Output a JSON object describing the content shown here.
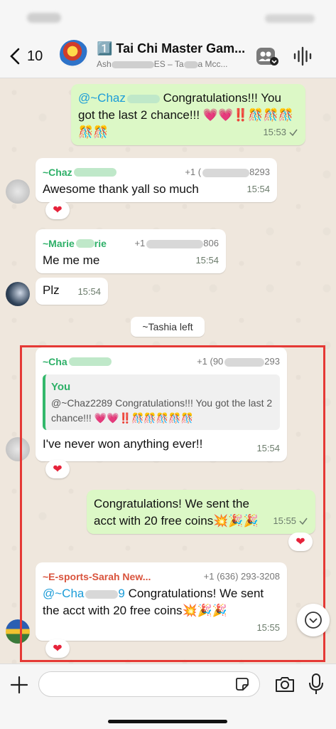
{
  "header": {
    "back_count": "10",
    "title": "1️⃣ Tai Chi Master Gam...",
    "subtitle_prefix": "Ash",
    "subtitle_mid": "ES – Ta",
    "subtitle_suffix": "a Mcc..."
  },
  "messages": {
    "m1": {
      "mention": "@~Chaz",
      "text": " Congratulations!!! You got the last 2 chance!!! 💗💗‼️🎊🎊🎊🎊🎊",
      "time": "15:53"
    },
    "m2": {
      "sender": "~Chaz",
      "phone_prefix": "+1 (",
      "phone_suffix": "8293",
      "text": "Awesome thank yall so much",
      "time": "15:54",
      "reaction": "❤"
    },
    "m3": {
      "sender": "~Marie",
      "sender_suffix": "rie",
      "phone_prefix": "+1",
      "phone_suffix": "806",
      "text": "Me me me",
      "time": "15:54"
    },
    "m4": {
      "text": "Plz",
      "time": "15:54"
    },
    "system": "~Tashia left",
    "m5": {
      "sender": "~Cha",
      "phone_prefix": "+1 (90",
      "phone_suffix": "293",
      "quote_title": "You",
      "quote_text": "@~Chaz2289 Congratulations!!! You got the last 2 chance!!! 💗💗‼️🎊🎊🎊🎊🎊",
      "text": "I've never won anything ever!!",
      "time": "15:54",
      "reaction": "❤"
    },
    "m6": {
      "text": "Congratulations! We sent the acct with 20 free coins💥🎉🎉",
      "time": "15:55",
      "reaction": "❤"
    },
    "m7": {
      "sender": "~E-sports-Sarah New...",
      "phone": "+1 (636) 293-3208",
      "mention": "@~Cha",
      "mention_suffix": "9",
      "text": " Congratulations! We sent the acct with 20 free coins💥🎉🎉",
      "time": "15:55",
      "reaction": "❤"
    }
  },
  "input": {
    "placeholder": ""
  },
  "colors": {
    "outgoing": "#dcf8c6",
    "incoming": "#ffffff",
    "sender_green": "#2eb068",
    "highlight": "#e53935"
  }
}
